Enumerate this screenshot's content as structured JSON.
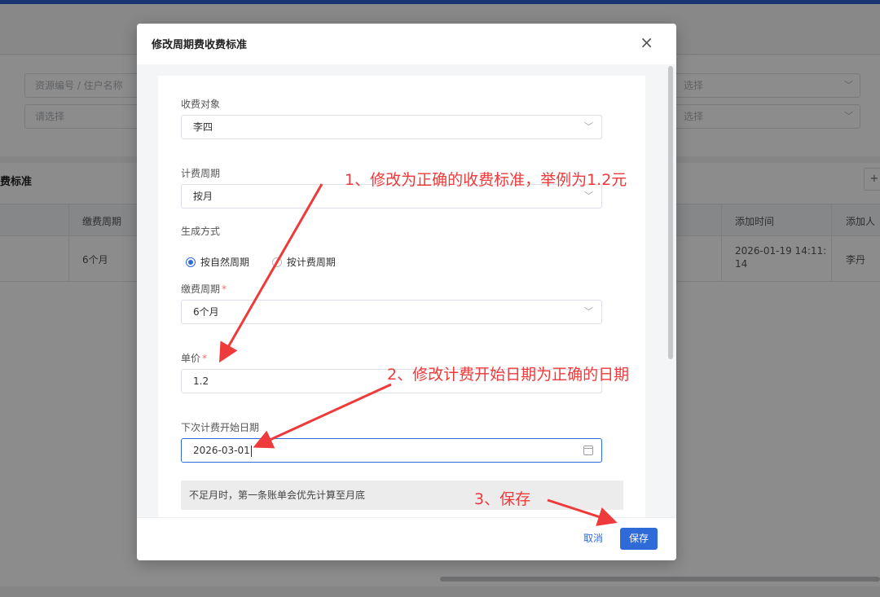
{
  "background": {
    "filters": {
      "search_placeholder": "资源编号 / 住户名称",
      "select_placeholder": "请选择",
      "right_select_1": "选择",
      "right_select_2": "选择"
    },
    "section_title": "费标准",
    "add_button": "+",
    "table": {
      "headers": [
        "缴费周期",
        "添加时间",
        "添加人"
      ],
      "row": {
        "period": "6个月",
        "added_time": "2026-01-19 14:11:\n14",
        "added_by": "李丹"
      }
    }
  },
  "modal": {
    "title": "修改周期费收费标准",
    "close_icon": "×",
    "fields": {
      "target_label": "收费对象",
      "target_value": "李四",
      "cycle_label": "计费周期",
      "cycle_value": "按月",
      "mode_label": "生成方式",
      "mode_options": [
        "按自然周期",
        "按计费周期"
      ],
      "mode_selected": "按自然周期",
      "pay_period_label": "缴费周期",
      "pay_period_value": "6个月",
      "price_label": "单价",
      "price_value": "1.2",
      "start_date_label": "下次计费开始日期",
      "start_date_value": "2026-03-01",
      "required_mark": "*"
    },
    "tip": "不足月时，第一条账单会优先计算至月底",
    "buttons": {
      "cancel": "取消",
      "save": "保存"
    }
  },
  "annotations": {
    "step1": "1、修改为正确的收费标准，举例为1.2元",
    "step2": "2、修改计费开始日期为正确的日期",
    "step3": "3、保存",
    "color": "#ee3a3a"
  }
}
